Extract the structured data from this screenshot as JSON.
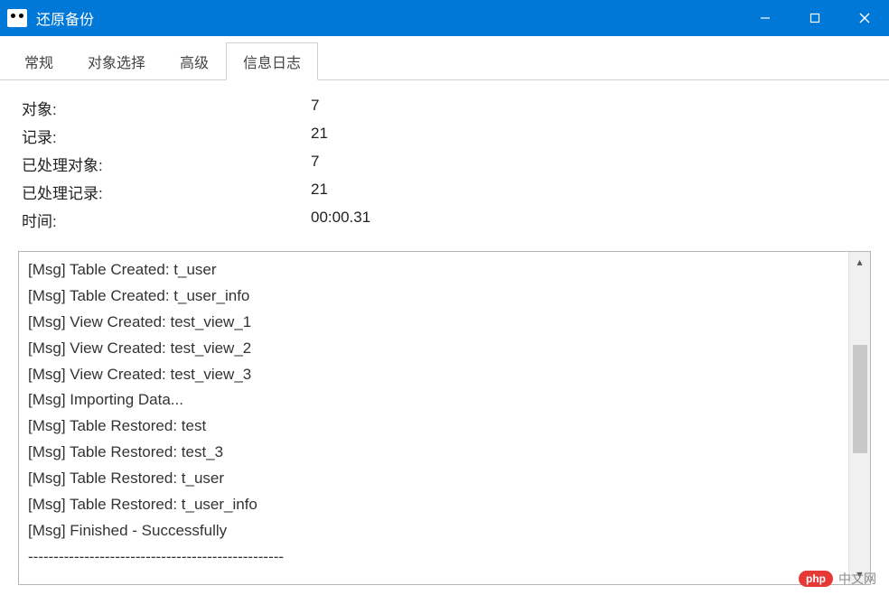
{
  "window": {
    "title": "还原备份"
  },
  "tabs": [
    {
      "label": "常规",
      "active": false
    },
    {
      "label": "对象选择",
      "active": false
    },
    {
      "label": "高级",
      "active": false
    },
    {
      "label": "信息日志",
      "active": true
    }
  ],
  "stats": {
    "objects_label": "对象:",
    "objects_value": "7",
    "records_label": "记录:",
    "records_value": "21",
    "processed_objects_label": "已处理对象:",
    "processed_objects_value": "7",
    "processed_records_label": "已处理记录:",
    "processed_records_value": "21",
    "time_label": "时间:",
    "time_value": "00:00.31"
  },
  "log": [
    "[Msg] Table Created: t_user",
    "[Msg] Table Created: t_user_info",
    "[Msg] View Created: test_view_1",
    "[Msg] View Created: test_view_2",
    "[Msg] View Created: test_view_3",
    "[Msg] Importing Data...",
    "[Msg] Table Restored: test",
    "[Msg] Table Restored: test_3",
    "[Msg] Table Restored: t_user",
    "[Msg] Table Restored: t_user_info",
    "[Msg] Finished - Successfully",
    "--------------------------------------------------"
  ],
  "watermark": {
    "badge": "php",
    "text": "中文网"
  }
}
